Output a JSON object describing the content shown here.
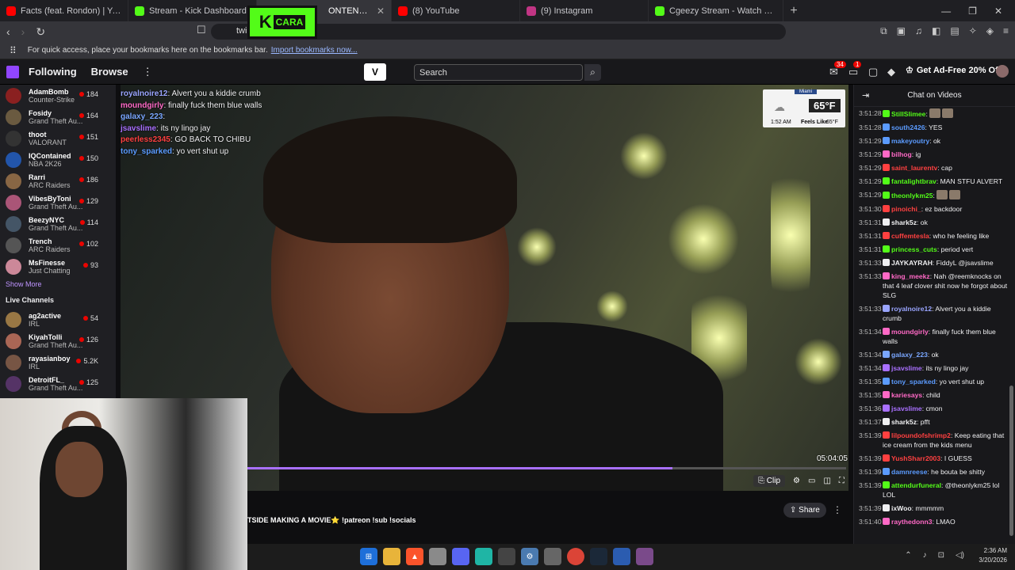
{
  "browser": {
    "tabs": [
      {
        "label": "Facts (feat. Rondon) | YouTube M",
        "color": "#ff0000"
      },
      {
        "label": "Stream - Kick Dashboard",
        "color": "#53fc18"
      },
      {
        "label": "ONTENT TYPE OF",
        "color": "#9146ff"
      },
      {
        "label": "(8) YouTube",
        "color": "#ff0000"
      },
      {
        "label": "(9) Instagram",
        "color": "#c13584"
      },
      {
        "label": "Cgeezy Stream - Watch Live on Kick",
        "color": "#53fc18"
      }
    ],
    "url": "twi                     89",
    "bookmarks_text": "For quick access, place your bookmarks here on the bookmarks bar.",
    "bookmarks_link": "Import bookmarks now..."
  },
  "overlay_logo": {
    "letter": "K",
    "text": "CARA"
  },
  "twitch": {
    "nav": {
      "following": "Following",
      "browse": "Browse",
      "search_placeholder": "Search",
      "adfree": "Get Ad-Free 20% Off",
      "notif_count": "34",
      "whisper_count": "1"
    },
    "followed": [
      {
        "name": "AdamBomb",
        "game": "Counter-Strike",
        "viewers": "184",
        "color": "#8a2020"
      },
      {
        "name": "Fosidy",
        "game": "Grand Theft Au...",
        "viewers": "164",
        "color": "#6a5a40"
      },
      {
        "name": "thoot",
        "game": "VALORANT",
        "viewers": "151",
        "color": "#333333"
      },
      {
        "name": "IQContained",
        "game": "NBA 2K26",
        "viewers": "150",
        "color": "#2255aa"
      },
      {
        "name": "Rarri",
        "game": "ARC Raiders",
        "viewers": "186",
        "color": "#886644"
      },
      {
        "name": "VibesByToni",
        "game": "Grand Theft Au...",
        "viewers": "129",
        "color": "#aa5577"
      },
      {
        "name": "BeezyNYC",
        "game": "Grand Theft Au...",
        "viewers": "114",
        "color": "#445566"
      },
      {
        "name": "Trench",
        "game": "ARC Raiders",
        "viewers": "102",
        "color": "#555555"
      },
      {
        "name": "MsFinesse",
        "game": "Just Chatting",
        "viewers": "93",
        "color": "#cc8899"
      }
    ],
    "show_more": "Show More",
    "live_heading": "Live Channels",
    "live": [
      {
        "name": "ag2active",
        "game": "IRL",
        "viewers": "54",
        "color": "#997744"
      },
      {
        "name": "KiyahTolli",
        "game": "Grand Theft Au...",
        "viewers": "126",
        "color": "#aa6655"
      },
      {
        "name": "rayasianboy",
        "game": "IRL",
        "viewers": "5.2K",
        "color": "#775544"
      },
      {
        "name": "DetroitFL_",
        "game": "Grand Theft Au...",
        "viewers": "125",
        "color": "#553366"
      }
    ]
  },
  "video": {
    "overlay_chat": [
      {
        "user": "royalnoire12",
        "color": "#9aa5ff",
        "msg": ": Alvert you a kiddie crumb"
      },
      {
        "user": "moundgirly",
        "color": "#ff69c6",
        "msg": ": finally fuck them blue walls"
      },
      {
        "user": "galaxy_223",
        "color": "#7aa7ff",
        "msg": ":"
      },
      {
        "user": "jsavslime",
        "color": "#a970ff",
        "msg": ": its ny lingo jay"
      },
      {
        "user": "peerless2345",
        "color": "#ff4040",
        "msg": ": GO BACK TO CHIBU"
      },
      {
        "user": "tony_sparked",
        "color": "#5b9bff",
        "msg": ": yo vert shut up"
      }
    ],
    "weather": {
      "city": "Miami",
      "temp": "65°F",
      "time": "1:52 AM",
      "feels_label": "Feels Like",
      "feels": "65°F"
    },
    "timecode": "05:04:05",
    "progress": 0.71,
    "clip_label": "Clip",
    "title": "TSIDE MAKING A MOVIE⭐ !patreon !sub !socials",
    "share_label": "Share"
  },
  "chat": {
    "header": "Chat on Videos",
    "messages": [
      {
        "ts": "3:51:28",
        "user": "StillSlimee",
        "color": "#53fc18",
        "msg": ":",
        "emote": true
      },
      {
        "ts": "3:51:28",
        "user": "south2426",
        "color": "#5b9bff",
        "msg": ": YES"
      },
      {
        "ts": "3:51:29",
        "user": "makeyoutry",
        "color": "#5b9bff",
        "msg": ": ok"
      },
      {
        "ts": "3:51:29",
        "user": "bilhog",
        "color": "#ff69c6",
        "msg": ": ig"
      },
      {
        "ts": "3:51:29",
        "user": "saint_laurentv",
        "color": "#ff4040",
        "msg": ": cap"
      },
      {
        "ts": "3:51:29",
        "user": "fantalightbrav",
        "color": "#53fc18",
        "msg": ": MAN STFU ALVERT"
      },
      {
        "ts": "3:51:29",
        "user": "theonlykm25",
        "color": "#53fc18",
        "msg": ":",
        "emote": true
      },
      {
        "ts": "3:51:30",
        "user": "pinoichi_",
        "color": "#ff4040",
        "msg": ": ez backdoor"
      },
      {
        "ts": "3:51:31",
        "user": "shark5z",
        "color": "#efeff1",
        "msg": ": ok"
      },
      {
        "ts": "3:51:31",
        "user": "cuffemtesla",
        "color": "#ff4040",
        "msg": ": who he feeling like"
      },
      {
        "ts": "3:51:31",
        "user": "princess_cuts",
        "color": "#53fc18",
        "msg": ": period vert"
      },
      {
        "ts": "3:51:33",
        "user": "JAYKAYRAH",
        "color": "#efeff1",
        "msg": ": FiddyL @jsavslime"
      },
      {
        "ts": "3:51:33",
        "user": "king_meekz",
        "color": "#ff69c6",
        "msg": ": Nah @reemknocks on that 4 leaf clover shit now he forgot about SLG"
      },
      {
        "ts": "3:51:33",
        "user": "royalnoire12",
        "color": "#9aa5ff",
        "msg": ": Alvert you a kiddie crumb"
      },
      {
        "ts": "3:51:34",
        "user": "moundgirly",
        "color": "#ff69c6",
        "msg": ": finally fuck them blue walls"
      },
      {
        "ts": "3:51:34",
        "user": "galaxy_223",
        "color": "#7aa7ff",
        "msg": ": ok"
      },
      {
        "ts": "3:51:34",
        "user": "jsavslime",
        "color": "#a970ff",
        "msg": ": its ny lingo jay"
      },
      {
        "ts": "3:51:35",
        "user": "tony_sparked",
        "color": "#5b9bff",
        "msg": ": yo vert shut up"
      },
      {
        "ts": "3:51:35",
        "user": "kariesays",
        "color": "#ff69c6",
        "msg": ": child"
      },
      {
        "ts": "3:51:36",
        "user": "jsavslime",
        "color": "#a970ff",
        "msg": ": cmon"
      },
      {
        "ts": "3:51:37",
        "user": "shark5z",
        "color": "#efeff1",
        "msg": ": pfft"
      },
      {
        "ts": "3:51:39",
        "user": "lilpoundofshrimp2",
        "color": "#ff4040",
        "msg": ": Keep eating that ice cream from the kids menu"
      },
      {
        "ts": "3:51:39",
        "user": "YushSharr2003",
        "color": "#ff4040",
        "msg": ": I GUESS"
      },
      {
        "ts": "3:51:39",
        "user": "damnreese",
        "color": "#5b9bff",
        "msg": ": he bouta be shitty"
      },
      {
        "ts": "3:51:39",
        "user": "attendurfuneral",
        "color": "#53fc18",
        "msg": ": @theonlykm25 lol LOL"
      },
      {
        "ts": "3:51:39",
        "user": "ixWoo",
        "color": "#efeff1",
        "msg": ": mmmmm"
      },
      {
        "ts": "3:51:40",
        "user": "raythedonn3",
        "color": "#ff69c6",
        "msg": ": LMAO"
      }
    ]
  },
  "taskbar": {
    "time": "2:36 AM",
    "date": "3/20/2026"
  }
}
